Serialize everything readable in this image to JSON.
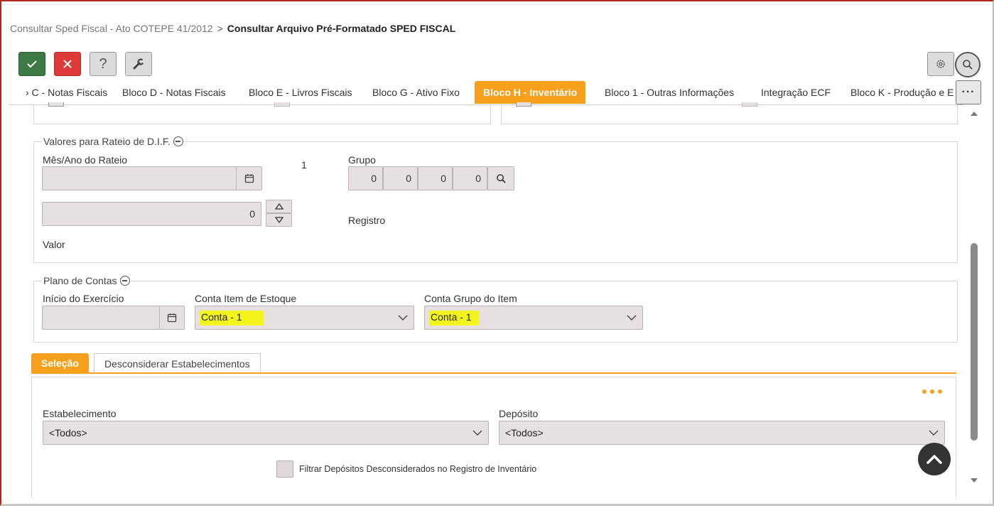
{
  "breadcrumb": {
    "parent": "Consultar Sped Fiscal - Ato COTEPE 41/2012",
    "separator": ">",
    "current": "Consultar Arquivo Pré-Formatado SPED FISCAL"
  },
  "toolbar": {
    "confirm_icon": "check-icon",
    "cancel_icon": "close-icon",
    "help_label": "?",
    "tools_icon": "wrench-icon",
    "settings_icon": "gear-icon",
    "search_icon": "search-icon"
  },
  "tabs": [
    {
      "label": "› C - Notas Fiscais",
      "active": false
    },
    {
      "label": "Bloco D - Notas Fiscais",
      "active": false
    },
    {
      "label": "Bloco E - Livros Fiscais",
      "active": false
    },
    {
      "label": "Bloco G - Ativo Fixo",
      "active": false
    },
    {
      "label": "Bloco H - Inventário",
      "active": true
    },
    {
      "label": "Bloco 1 - Outras Informações",
      "active": false
    },
    {
      "label": "Integração ECF",
      "active": false
    },
    {
      "label": "Bloco K - Produção e E",
      "active": false
    }
  ],
  "tabs_more_label": "···",
  "rateio": {
    "legend": "Valores para Rateio de D.I.F.",
    "mes_ano_label": "Mês/Ano do Rateio",
    "mes_ano_value": "",
    "side_number": "1",
    "valor_spinner_value": "0",
    "valor_label": "Valor",
    "grupo_label": "Grupo",
    "grupo_values": [
      "0",
      "0",
      "0",
      "0"
    ],
    "registro_label": "Registro"
  },
  "plano_contas": {
    "legend": "Plano de Contas",
    "inicio_label": "Início do Exercício",
    "inicio_value": "",
    "conta_item_label": "Conta Item de Estoque",
    "conta_item_value": "Conta - 1",
    "conta_grupo_label": "Conta Grupo do Item",
    "conta_grupo_value": "Conta - 1"
  },
  "subtabs": [
    {
      "label": "Seleção",
      "active": true
    },
    {
      "label": "Desconsiderar Estabelecimentos",
      "active": false
    }
  ],
  "selecao": {
    "estabelecimento_label": "Estabelecimento",
    "estabelecimento_value": "<Todos>",
    "deposito_label": "Depósito",
    "deposito_value": "<Todos>",
    "filtrar_label": "Filtrar Depósitos Desconsiderados no Registro de Inventário",
    "filtrar_checked": false
  },
  "colors": {
    "accent": "#f7a01e",
    "confirm": "#3e7a46",
    "cancel": "#de3a3a",
    "highlight": "#f4f51a",
    "input_bg": "#e6e0e0"
  }
}
